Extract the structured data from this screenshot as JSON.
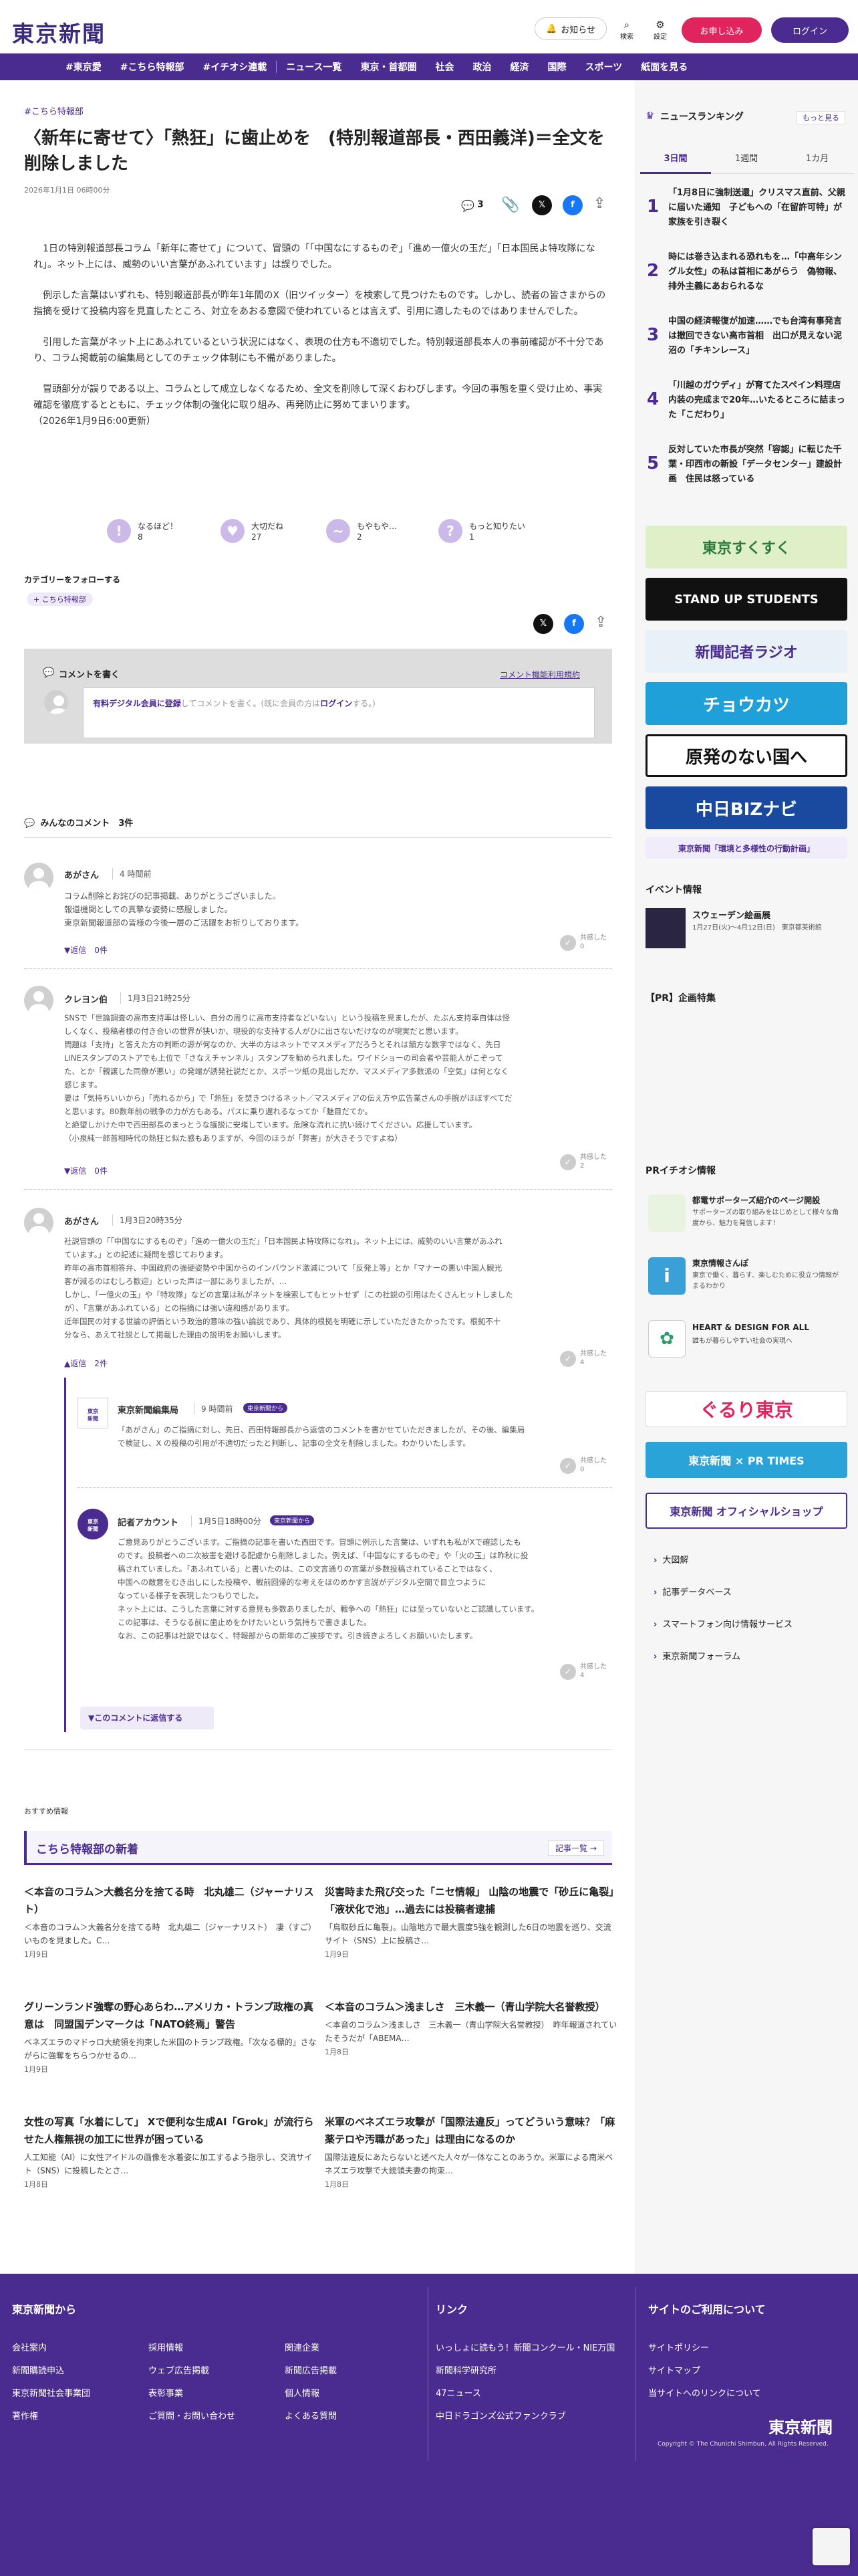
{
  "header": {
    "logo": "東京新聞",
    "notice_label": "お知らせ",
    "search_label": "検索",
    "settings_label": "設定",
    "subscribe_label": "お申し込み",
    "login_label": "ログイン"
  },
  "nav": {
    "items": [
      "#東京愛",
      "#こちら特報部",
      "#イチオシ連載",
      "ニュース一覧",
      "東京・首都圏",
      "社会",
      "政治",
      "経済",
      "国際",
      "スポーツ",
      "紙面を見る"
    ]
  },
  "article": {
    "tag": "#こちら特報部",
    "title": "〈新年に寄せて〉「熱狂」に歯止めを　(特別報道部長・西田義洋)＝全文を削除しました",
    "date": "2026年1月1日 06時00分",
    "comment_count": "3",
    "paragraphs": [
      "1日の特別報道部長コラム「新年に寄せて」について、冒頭の「「中国なにするものぞ」「進め一億火の玉だ」「日本国民よ特攻隊になれ」。ネット上には、威勢のいい言葉があふれています」は誤りでした。",
      "例示した言葉はいずれも、特別報道部長が昨年1年間のX（旧ツイッター）を検索して見つけたものです。しかし、読者の皆さまからの指摘を受けて投稿内容を見直したところ、対立をあおる意図で使われているとは言えず、引用に適したものではありませんでした。",
      "引用した言葉がネット上にあふれているという状況にはなく、表現の仕方も不適切でした。特別報道部長本人の事前確認が不十分であり、コラム掲載前の編集局としてのチェック体制にも不備がありました。",
      "冒頭部分が誤りである以上、コラムとして成立しなくなるため、全文を削除して深くおわびします。今回の事態を重く受け止め、事実確認を徹底するとともに、チェック体制の強化に取り組み、再発防止に努めてまいります。"
    ],
    "update_note": "（2026年1月9日6:00更新）",
    "reactions": [
      {
        "label": "なるほど！",
        "count": "8"
      },
      {
        "label": "大切だね",
        "count": "27"
      },
      {
        "label": "もやもや…",
        "count": "2"
      },
      {
        "label": "もっと知りたい",
        "count": "1"
      }
    ],
    "follow_title": "カテゴリーをフォローする",
    "follow_tag": "+ こちら特報部"
  },
  "comment_form": {
    "title": "コメントを書く",
    "terms": "コメント機能利用規約",
    "placeholder_pre": "有料デジタル会員に登録",
    "placeholder_mid": "してコメントを書く。(既に会員の方は",
    "placeholder_login": "ログイン",
    "placeholder_post": "する。)"
  },
  "comments_header": "みんなのコメント　3件",
  "comments": [
    {
      "name": "あがさん",
      "time": "4 時間前",
      "lines": [
        "コラム削除とお詫びの記事掲載、ありがとうございました。",
        "報道機関としての真摯な姿勢に感服しました。",
        "東京新聞報道部の皆様の今後一層のご活躍をお祈りしております。"
      ],
      "reply": "返信　0件",
      "like": "共感した",
      "like_n": "0"
    },
    {
      "name": "クレヨン伯",
      "time": "1月3日21時25分",
      "lines": [
        "SNSで「世論調査の高市支持率は怪しい、自分の周りに高市支持者などいない」という投稿を見ましたが、たぶん支持率自体は怪",
        "しくなく、投稿者様の付き合いの世界が狭いか、現役的な支持する人がひに出さないだけなのが現実だと思います。",
        "問題は「支持」と答えた方の判断の源が何なのか、大半の方はネットでマスメディアだろうとそれは頷方な数字ではなく、先日",
        "LINEスタンプのストアでも上位で「さなえチャンネル」スタンプを勧められました。ワイドショーの司会者や芸能人がこぞって",
        "た、とか「親譲した同僚が悪い」の発端が誘発社説だとか、スポーツ紙の見出しだか、マスメディア多数派の「空気」は何となく",
        "感じます。",
        "要は「気持ちいいから」「売れるから」で「熱狂」を焚きつけるネット／マスメディアの伝え方や広告業さんの手腕がほぼすべてだ",
        "と思います。80数年前の戦争の力が方もある。パスに乗り遅れるなってか「魅目だてか。",
        "と絶望しかけた中で西田部長のまっとうな議説に安堵しています。危険な流れに抗い続けてください。応援しています。",
        "（小泉純一郎首相時代の熱狂と似た感もありますが、今回のほうが「弊害」が大きそうですよね）"
      ],
      "reply": "返信　0件",
      "like": "共感した",
      "like_n": "2"
    },
    {
      "name": "あがさん",
      "time": "1月3日20時35分",
      "lines": [
        "社説冒頭の「「中国なにするものぞ」「進め一億火の玉だ」「日本国民よ特攻隊になれ」。ネット上には、威勢のいい言葉があふれ",
        "ています。」との記述に疑問を感じております。",
        "昨年の高市首相答弁、中国政府の強硬姿勢や中国からのインバウンド激減について「反発上等」とか「マナーの悪い中国人観光",
        "客が減るのはむしろ歓迎」といった声は一部にありましたが、…",
        "しかし、「一億火の玉」や「特攻隊」などの言葉は私がネットを検索してもヒットせず（この社説の引用はたくさんヒットしました",
        "が）、「言葉があふれている」との指摘には強い違和感があります。",
        "近年国民の対する世論の評価という政治的意味の強い論説であり、具体的根拠を明確に示していただきたかったです。根拠不十",
        "分なら、あえて社説として掲載した理由の説明をお願いします。"
      ],
      "reply": "返信　2件",
      "like": "共感した",
      "like_n": "4",
      "replies": [
        {
          "name": "東京新聞編集局",
          "time": "9 時間前",
          "badge": "東京新聞から",
          "lines": [
            "「あがさん」のご指摘に対し、先日、西田特報部長から返信のコメントを書かせていただきましたが、その後、編集局",
            "で検証し、X の投稿の引用が不適切だったと判断し、記事の全文を削除しました。わかりいたします。"
          ],
          "like": "共感した",
          "like_n": "0"
        },
        {
          "name": "記者アカウント",
          "time": "1月5日18時00分",
          "badge": "東京新聞から",
          "lines": [
            "ご意見ありがとうございます。ご指摘の記事を書いた西田です。冒頭に例示した言葉は、いずれも私がXで確認したも",
            "のです。投稿者への二次被害を避ける配慮から削除しました。例えば、「中国なにするものぞ」や「火の玉」は昨秋に投",
            "稿されていました。「あふれている」と書いたのは、この文言通りの言葉が多数投稿されていることではなく、",
            "中国への敵意をむき出しにした投稿や、戦前回帰的な考えをほのめかす言説がデジタル空間で目立つように",
            "なっている様子を表現したつもりでした。",
            "ネット上には、こうした言葉に対する意見も多数ありましたが、戦争への「熱狂」には至っていないとご認識しています。",
            "この記事は、そうなる前に歯止めをかけたいという気持ちで書きました。",
            "なお、この記事は社説ではなく、特報部からの新年のご挨拶です。引き続きよろしくお願いいたします。"
          ],
          "like": "共感した",
          "like_n": "4"
        }
      ],
      "reply_button": "▼このコメントに返信する"
    }
  ],
  "recommend_label": "おすすめ情報",
  "special_section": {
    "title": "こちら特報部の新着",
    "more": "記事一覧 →"
  },
  "news_cards": [
    {
      "title": "＜本音のコラム＞大義名分を捨てる時　北丸雄二（ジャーナリスト）",
      "body": "＜本音のコラム＞大義名分を捨てる時　北丸雄二（ジャーナリスト）　凄（すご）いものを見ました。C…",
      "date": "1月9日"
    },
    {
      "title": "災害時また飛び交った「ニセ情報」 山陰の地震で「砂丘に亀裂」「液状化で池」…過去には投稿者逮捕",
      "body": "「鳥取砂丘に亀裂」。山陰地方で最大震度5強を観測した6日の地震を巡り、交流サイト（SNS）上に投稿さ…",
      "date": "1月9日"
    },
    {
      "title": "グリーンランド強奪の野心あらわ…アメリカ・トランプ政権の真意は　同盟国デンマークは「NATO終焉」警告",
      "body": "ベネズエラのマドゥロ大統領を拘束した米国のトランプ政権。「次なる標的」さながらに強奪をちらつかせるの…",
      "date": "1月9日"
    },
    {
      "title": "＜本音のコラム＞浅ましさ　三木義一（青山学院大名誉教授）",
      "body": "＜本音のコラム＞浅ましさ　三木義一（青山学院大名誉教授）　昨年報道されていたそうだが「ABEMA…",
      "date": "1月8日"
    },
    {
      "title": "女性の写真「水着にして」 Xで便利な生成AI「Grok」が流行らせた人権無視の加工に世界が困っている",
      "body": "人工知能（AI）に女性アイドルの画像を水着姿に加工するよう指示し、交流サイト（SNS）に投稿したとさ…",
      "date": "1月8日"
    },
    {
      "title": "米軍のベネズエラ攻撃が「国際法違反」ってどういう意味？「麻薬テロや汚職があった」は理由になるのか",
      "body": "国際法違反にあたらないと述べた人々が一体なことのあうか。米軍による南米ベネズエラ攻撃で大統領夫妻の拘束…",
      "date": "1月8日"
    }
  ],
  "sidebar": {
    "ranking_title": "ニュースランキング",
    "ranking_more": "もっと見る",
    "tabs": [
      "3日間",
      "1週間",
      "1カ月"
    ],
    "ranking": [
      {
        "n": "1",
        "title": "「1月8日に強制送還」クリスマス直前、父親に届いた通知　子どもへの「在留許可特」が家族を引き裂く"
      },
      {
        "n": "2",
        "title": "時には巻き込まれる恐れもを…「中高年シングル女性」の私は首相にあがらう　偽物報、排外主義にあおられるな"
      },
      {
        "n": "3",
        "title": "中国の経済報復が加速……でも台湾有事発言は撤回できない高市首相　出口が見えない泥沼の「チキンレース」"
      },
      {
        "n": "4",
        "title": "「川越のガウディ」が育てたスペイン料理店　内装の完成まで20年…いたるところに詰まった「こだわり」"
      },
      {
        "n": "5",
        "title": "反対していた市長が突然「容認」に転じた千葉・印西市の新設「データセンター」建設計画　住民は怒っている"
      }
    ],
    "banners": [
      "東京すくすく",
      "STAND UP STUDENTS",
      "新聞記者ラジオ",
      "チョウカツ",
      "原発のない国へ",
      "中日BIZナビ",
      "東京新聞「環境と多様性の行動計画」"
    ],
    "event_title": "イベント情報",
    "event": {
      "title": "スウェーデン絵画展",
      "body": "1月27日(火)〜4月12日(日)　東京都美術館"
    },
    "pr_title": "【PR】企画特集",
    "pr2_title": "PRイチオシ情報",
    "pr_items": [
      {
        "title": "都電サポーターズ紹介のページ開設",
        "body": "サポーターズの取り組みをはじめとして様々な角度から、魅力を発信します！"
      },
      {
        "title": "東京情報さんぽ",
        "body": "東京で働く、暮らす、楽しむために役立つ情報がまるわかり"
      },
      {
        "title": "HEART & DESIGN FOR ALL",
        "body": "誰もが暮らしやすい社会の実現へ"
      }
    ],
    "banners2": [
      "ぐるり東京",
      "東京新聞 × PR TIMES",
      "東京新聞 オフィシャルショップ"
    ],
    "links": [
      "大図解",
      "記事データベース",
      "スマートフォン向け情報サービス",
      "東京新聞フォーラム"
    ]
  },
  "footer": {
    "from_title": "東京新聞から",
    "col1": [
      "会社案内",
      "新聞購読申込",
      "東京新聞社会事業団",
      "著作権"
    ],
    "col2": [
      "採用情報",
      "ウェブ広告掲載",
      "表彰事業",
      "ご質問・お問い合わせ"
    ],
    "col3": [
      "関連企業",
      "新聞広告掲載",
      "個人情報",
      "よくある質問"
    ],
    "link_title": "リンク",
    "links": [
      "いっしょに読もう！新聞コンクール・NIE万国",
      "新聞科学研究所",
      "47ニュース",
      "中日ドラゴンズ公式ファンクラブ"
    ],
    "site_title": "サイトのご利用について",
    "site": [
      "サイトポリシー",
      "サイトマップ",
      "当サイトへのリンクについて"
    ],
    "logo": "東京新聞",
    "copyright": "Copyright © The Chunichi Shimbun, All Rights Reserved."
  },
  "colors": {
    "brand": "#4a2b8f",
    "accent": "#e0245e"
  }
}
